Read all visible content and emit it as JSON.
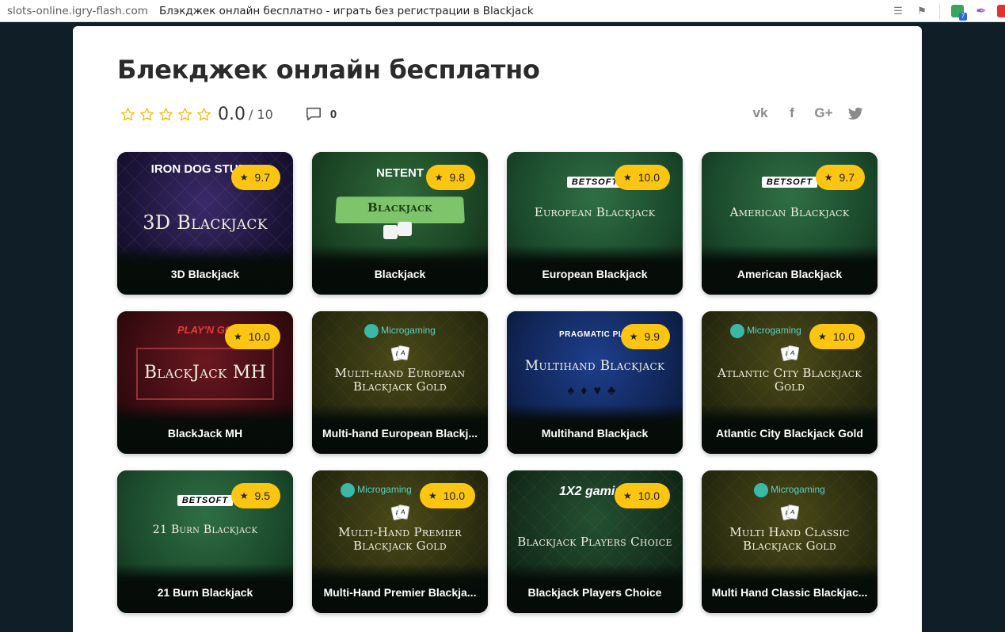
{
  "browser": {
    "url": "slots-online.igry-flash.com",
    "title": "Блэкджек онлайн бесплатно - играть без регистрации в Blackjack"
  },
  "page": {
    "heading": "Блекджек онлайн бесплатно",
    "rating_value": "0.0",
    "rating_max": "/ 10",
    "comment_count": "0"
  },
  "colors": {
    "accent_rating": "#fcc512",
    "star_outline": "#f5b800",
    "background": "#0f1e27"
  },
  "share": [
    "vk-icon",
    "facebook-icon",
    "google-plus-icon",
    "twitter-icon"
  ],
  "games": [
    {
      "name": "3D Blackjack",
      "rating": "9.7",
      "provider": "IRON DOG STUDIO",
      "art_title": "3D Blackjack"
    },
    {
      "name": "Blackjack",
      "rating": "9.8",
      "provider": "NETENT",
      "art_title": "Blackjack"
    },
    {
      "name": "European Blackjack",
      "rating": "10.0",
      "provider": "BETSOFT",
      "art_title": "European Blackjack"
    },
    {
      "name": "American Blackjack",
      "rating": "9.7",
      "provider": "BETSOFT",
      "art_title": "American Blackjack"
    },
    {
      "name": "BlackJack MH",
      "rating": "10.0",
      "provider": "PLAY'N GO",
      "art_title": "BlackJack MH"
    },
    {
      "name": "Multi-hand European Blackj...",
      "rating": "",
      "provider": "Microgaming",
      "art_title": "Multi-hand European Blackjack Gold"
    },
    {
      "name": "Multihand Blackjack",
      "rating": "9.9",
      "provider": "PRAGMATIC PLAY",
      "art_title": "Multihand Blackjack"
    },
    {
      "name": "Atlantic City Blackjack Gold",
      "rating": "10.0",
      "provider": "Microgaming",
      "art_title": "Atlantic City Blackjack Gold"
    },
    {
      "name": "21 Burn Blackjack",
      "rating": "9.5",
      "provider": "BETSOFT",
      "art_title": "21 Burn Blackjack"
    },
    {
      "name": "Multi-Hand Premier Blackja...",
      "rating": "10.0",
      "provider": "Microgaming",
      "art_title": "Multi-Hand Premier Blackjack Gold"
    },
    {
      "name": "Blackjack Players Choice",
      "rating": "10.0",
      "provider": "1X2 gaming",
      "art_title": "Blackjack Players Choice"
    },
    {
      "name": "Multi Hand Classic Blackjac...",
      "rating": "",
      "provider": "Microgaming",
      "art_title": "Multi Hand Classic Blackjack Gold"
    }
  ]
}
